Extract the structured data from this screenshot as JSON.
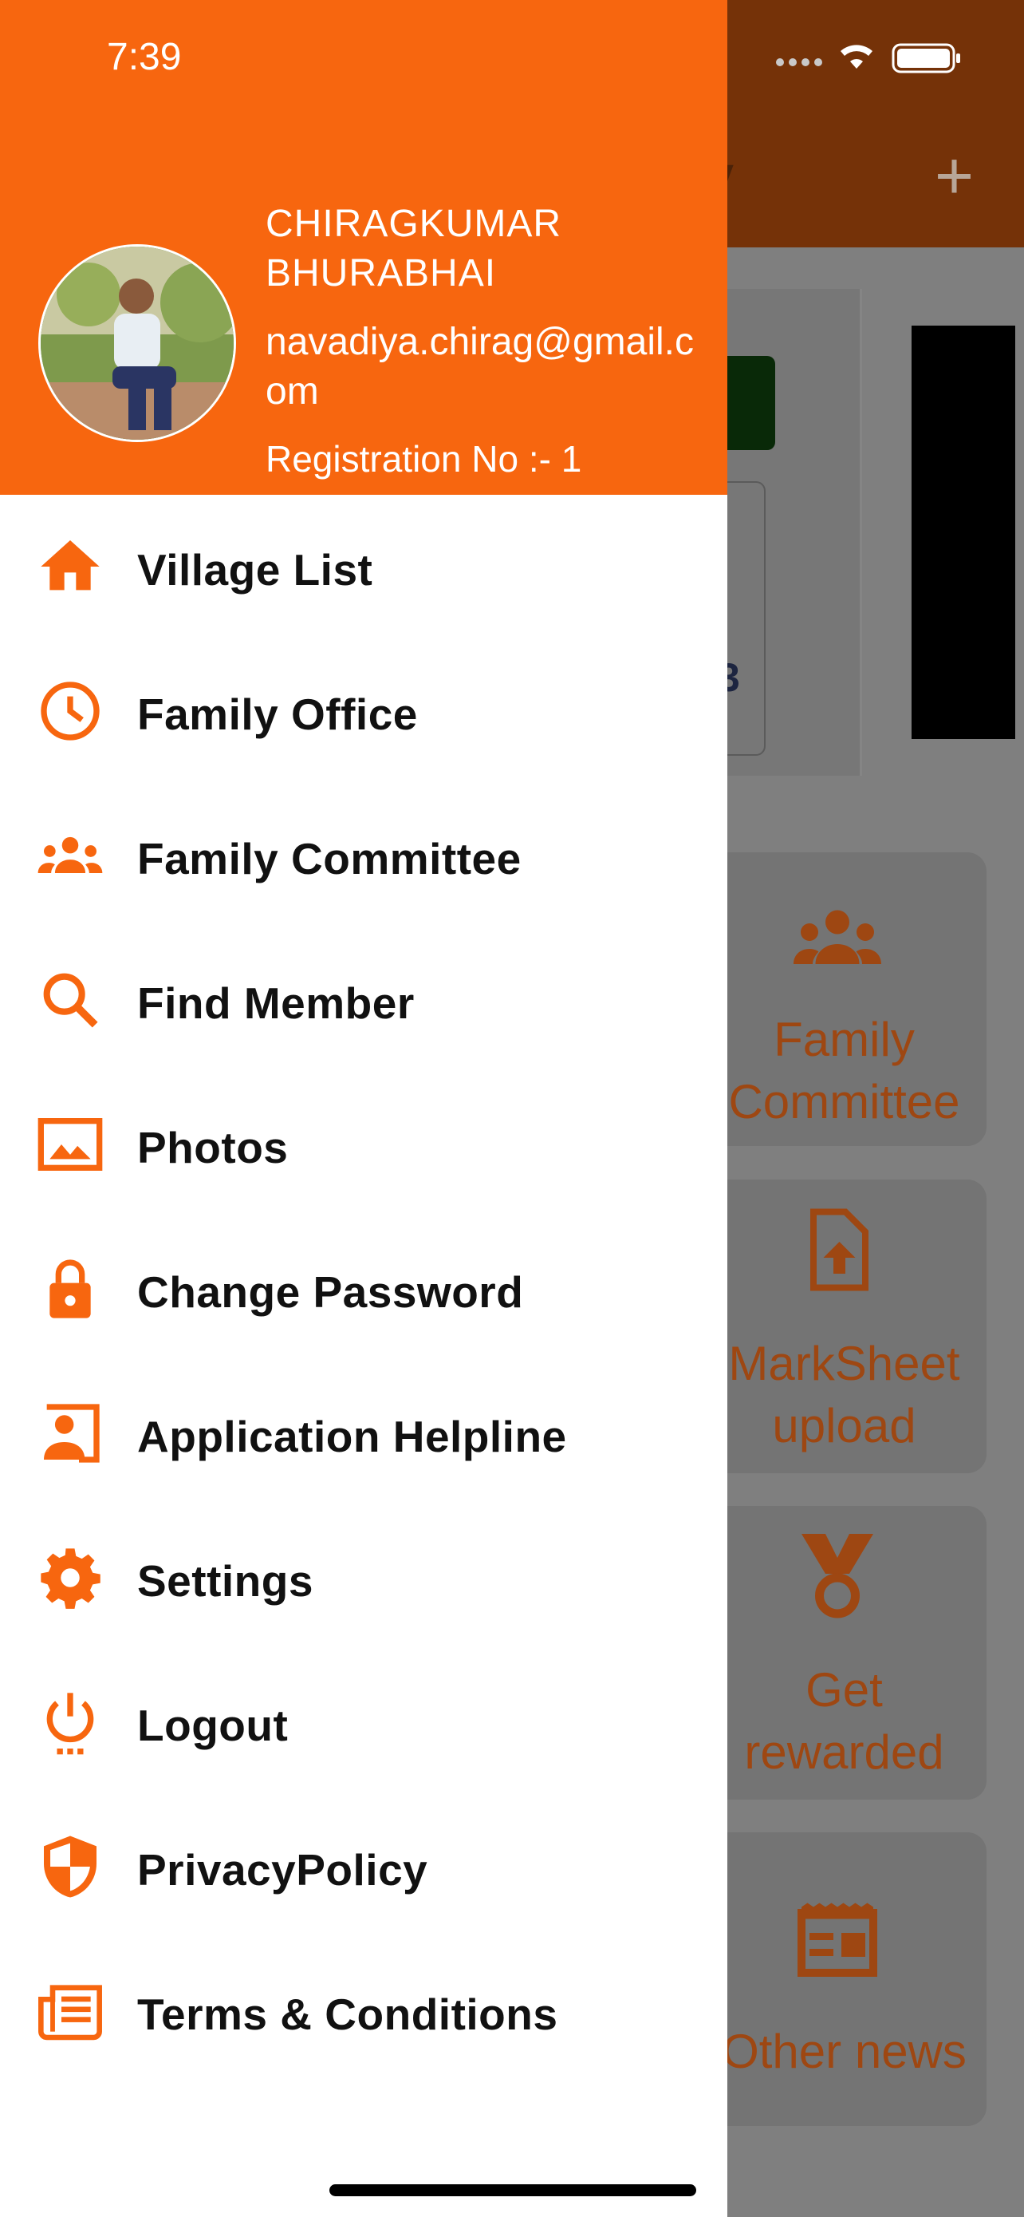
{
  "status_bar": {
    "time": "7:39"
  },
  "app_background": {
    "title_fragment": "y",
    "add_symbol": "+",
    "card_digit": "3",
    "tiles": [
      {
        "icon": "group-icon",
        "label": "Family Committee"
      },
      {
        "icon": "file-upload-icon",
        "label": "MarkSheet upload"
      },
      {
        "icon": "medal-icon",
        "label": "Get rewarded"
      },
      {
        "icon": "newspaper-icon",
        "label": "Other news"
      }
    ]
  },
  "drawer": {
    "user": {
      "name": "CHIRAGKUMAR BHURABHAI",
      "email": "navadiya.chirag@gmail.com",
      "registration": "Registration No :- 1"
    },
    "menu": [
      {
        "icon": "home-icon",
        "label": "Village List"
      },
      {
        "icon": "clock-icon",
        "label": "Family Office"
      },
      {
        "icon": "group-icon",
        "label": "Family Committee"
      },
      {
        "icon": "search-icon",
        "label": "Find Member"
      },
      {
        "icon": "image-icon",
        "label": "Photos"
      },
      {
        "icon": "lock-icon",
        "label": "Change Password"
      },
      {
        "icon": "contact-icon",
        "label": "Application Helpline"
      },
      {
        "icon": "gear-icon",
        "label": "Settings"
      },
      {
        "icon": "power-icon",
        "label": "Logout"
      },
      {
        "icon": "shield-icon",
        "label": "PrivacyPolicy"
      },
      {
        "icon": "newspaper-icon",
        "label": "Terms & Conditions"
      }
    ]
  },
  "colors": {
    "accent": "#f7660f",
    "scrim": "#7f7f7f",
    "drawer_bg": "#ffffff",
    "menu_text": "#111111"
  }
}
